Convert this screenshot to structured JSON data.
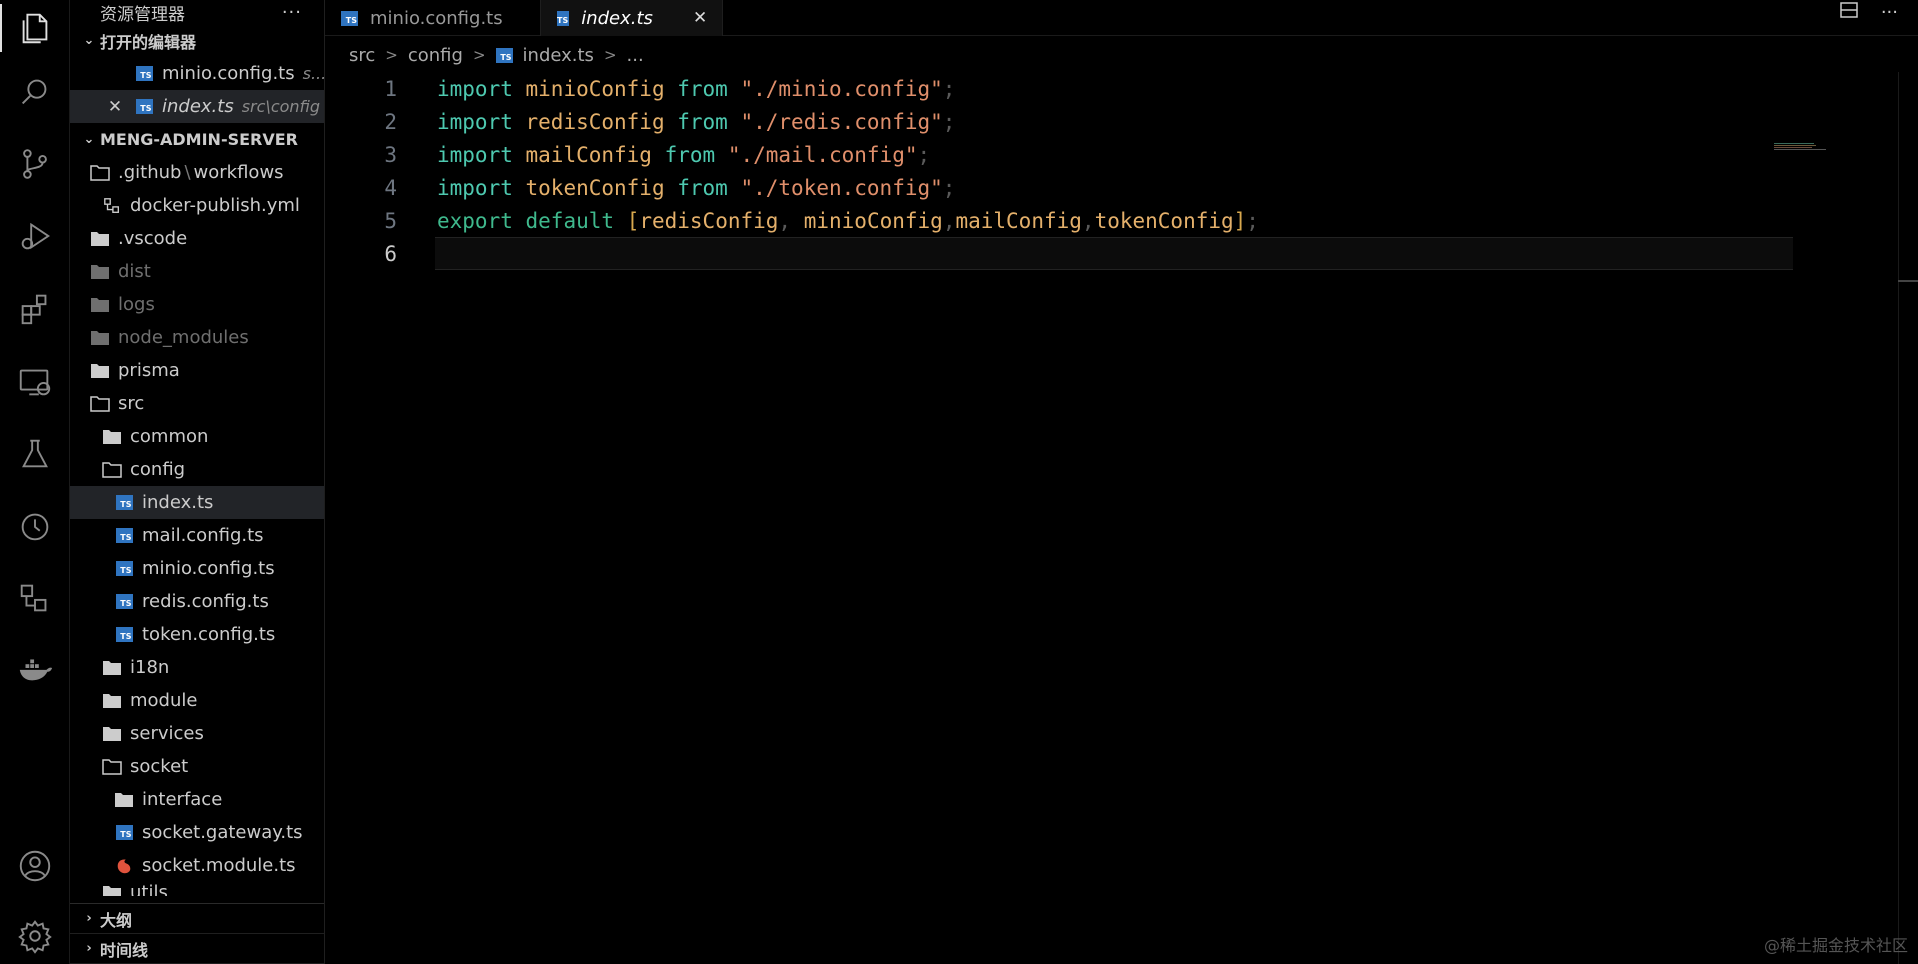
{
  "sidebar": {
    "title": "资源管理器",
    "more": "···",
    "open_editors": {
      "label": "打开的编辑器",
      "items": [
        {
          "name": "minio.config.ts",
          "sub": "s..."
        },
        {
          "name": "index.ts",
          "sub": "src\\config"
        }
      ]
    },
    "project": {
      "label": "MENG-ADMIN-SERVER",
      "tree": {
        "github": ".github",
        "github_sep": "\\",
        "workflows": "workflows",
        "docker": "docker-publish.yml",
        "vscode": ".vscode",
        "dist": "dist",
        "logs": "logs",
        "node_modules": "node_modules",
        "prisma": "prisma",
        "src": "src",
        "common": "common",
        "config": "config",
        "index": "index.ts",
        "mail": "mail.config.ts",
        "minio": "minio.config.ts",
        "redis": "redis.config.ts",
        "token": "token.config.ts",
        "i18n": "i18n",
        "module": "module",
        "services": "services",
        "socket": "socket",
        "interface": "interface",
        "socket_gateway": "socket.gateway.ts",
        "socket_module": "socket.module.ts",
        "utils_partial": "utils"
      }
    },
    "outline": "大纲",
    "timeline": "时间线"
  },
  "tabs": [
    {
      "label": "minio.config.ts",
      "active": false
    },
    {
      "label": "index.ts",
      "active": true
    }
  ],
  "ts_badge": "TS",
  "breadcrumb": {
    "parts": [
      "src",
      "config",
      "index.ts",
      "..."
    ],
    "sep": ">"
  },
  "editor": {
    "line_numbers": [
      "1",
      "2",
      "3",
      "4",
      "5",
      "6"
    ],
    "lines": [
      {
        "kw": "import",
        "id": "minioConfig",
        "from": "from",
        "str": "\"./minio.config\"",
        "semi": ";"
      },
      {
        "kw": "import",
        "id": "redisConfig",
        "from": "from",
        "str": "\"./redis.config\"",
        "semi": ";"
      },
      {
        "kw": "import",
        "id": "mailConfig",
        "from": "from",
        "str": "\"./mail.config\"",
        "semi": ";"
      },
      {
        "kw": "import",
        "id": "tokenConfig",
        "from": "from",
        "str": "\"./token.config\"",
        "semi": ";"
      }
    ],
    "export_line": {
      "kw1": "export",
      "kw2": "default",
      "open": "[",
      "a": "redisConfig",
      "c1": ",",
      "b": "minioConfig",
      "c2": ",",
      "c": "mailConfig",
      "c3": ",",
      "d": "tokenConfig",
      "close": "]",
      "semi": ";"
    }
  },
  "watermark": "@稀土掘金技术社区",
  "colors": {
    "ts_icon": "#2f74c0",
    "keyword": "#4ec9b0",
    "identifier": "#e4b06b",
    "string": "#e08f6b"
  }
}
